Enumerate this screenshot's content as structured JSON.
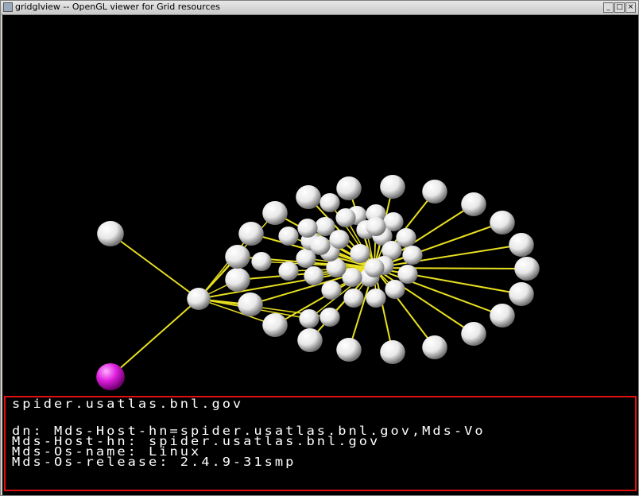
{
  "window": {
    "title": "gridglview -- OpenGL viewer for Grid resources",
    "buttons": {
      "minimize": "_",
      "maximize": "□",
      "close": "×"
    }
  },
  "scene": {
    "background": "#000000",
    "edge_color": "#e8e020",
    "node_color": "#f2f2f2",
    "selected_node_color": "#d010d0"
  },
  "info_panel": {
    "border_color": "#e01010",
    "lines": [
      "spider.usatlas.bnl.gov",
      "",
      "dn: Mds-Host-hn=spider.usatlas.bnl.gov,Mds-Vo",
      "Mds-Host-hn: spider.usatlas.bnl.gov",
      "Mds-Os-name: Linux",
      "Mds-Os-release: 2.4.9-31smp"
    ]
  }
}
